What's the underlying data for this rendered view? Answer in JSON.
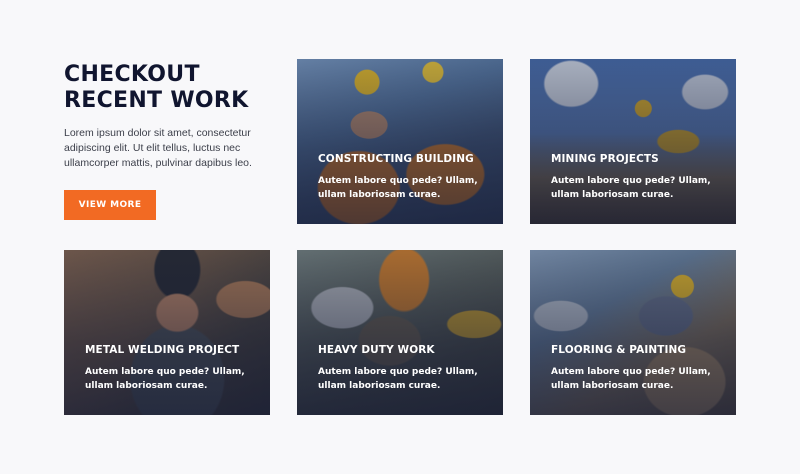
{
  "intro": {
    "title_line1": "CHECKOUT",
    "title_line2": "RECENT WORK",
    "description": "Lorem ipsum dolor sit amet, consectetur adipiscing elit. Ut elit tellus, luctus nec ullamcorper mattis, pulvinar dapibus leo.",
    "button_label": "VIEW MORE"
  },
  "colors": {
    "accent": "#f26a23",
    "heading": "#10152f",
    "background": "#f8f8fa"
  },
  "cards": [
    {
      "title": "CONSTRUCTING BUILDING",
      "description": "Autem labore quo pede? Ullam, ullam laboriosam curae."
    },
    {
      "title": "MINING PROJECTS",
      "description": "Autem labore quo pede? Ullam, ullam laboriosam curae."
    },
    {
      "title": "METAL WELDING PROJECT",
      "description": "Autem labore quo pede? Ullam, ullam laboriosam curae."
    },
    {
      "title": "HEAVY DUTY WORK",
      "description": "Autem labore quo pede? Ullam, ullam laboriosam curae."
    },
    {
      "title": "FLOORING & PAINTING",
      "description": "Autem labore quo pede? Ullam, ullam laboriosam curae."
    }
  ]
}
